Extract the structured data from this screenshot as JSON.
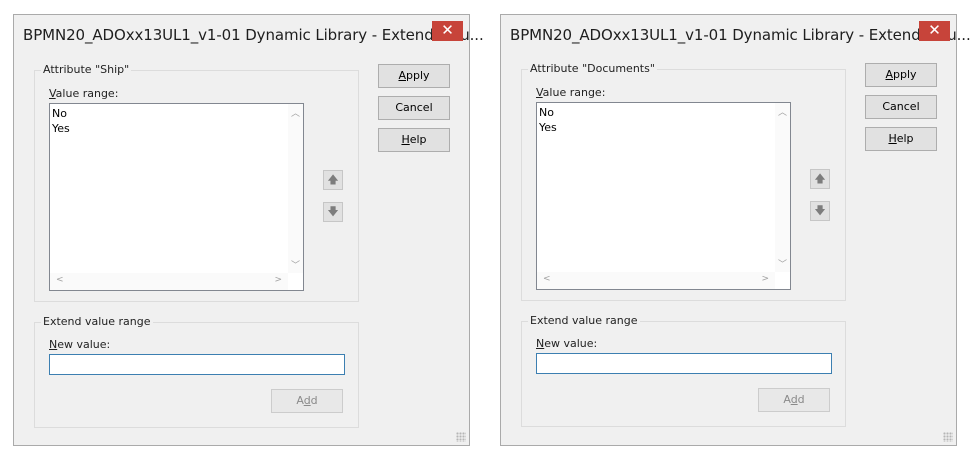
{
  "dialogs": [
    {
      "title": "BPMN20_ADOxx13UL1_v1-01 Dynamic Library - Extend valu...",
      "close_glyph": "✕",
      "attribute_group": "Attribute \"Ship\"",
      "value_range_label": "alue range:",
      "value_range_accel": "V",
      "values": [
        "No",
        "Yes"
      ],
      "buttons": {
        "apply": {
          "accel": "A",
          "rest": "pply"
        },
        "cancel": "Cancel",
        "help": {
          "accel": "H",
          "rest": "elp"
        }
      },
      "extend_group": "Extend value range",
      "new_value_label": "ew value:",
      "new_value_accel": "N",
      "new_value": "",
      "add": {
        "before": "A",
        "accel": "d",
        "after": "d"
      }
    },
    {
      "title": "BPMN20_ADOxx13UL1_v1-01 Dynamic Library - Extend valu...",
      "close_glyph": "✕",
      "attribute_group": "Attribute \"Documents\"",
      "value_range_label": "alue range:",
      "value_range_accel": "V",
      "values": [
        "No",
        "Yes"
      ],
      "buttons": {
        "apply": {
          "accel": "A",
          "rest": "pply"
        },
        "cancel": "Cancel",
        "help": {
          "accel": "H",
          "rest": "elp"
        }
      },
      "extend_group": "Extend value range",
      "new_value_label": "ew value:",
      "new_value_accel": "N",
      "new_value": "",
      "add": {
        "before": "A",
        "accel": "d",
        "after": "d"
      }
    }
  ],
  "icons": {
    "up": "🡅",
    "down": "🡇",
    "scroll_up": "︿",
    "scroll_down": "﹀",
    "scroll_left": "<",
    "scroll_right": ">"
  },
  "colors": {
    "close_button": "#c7443a",
    "dialog_background": "#f0f0f0",
    "input_border_focus": "#3c7fb1"
  }
}
